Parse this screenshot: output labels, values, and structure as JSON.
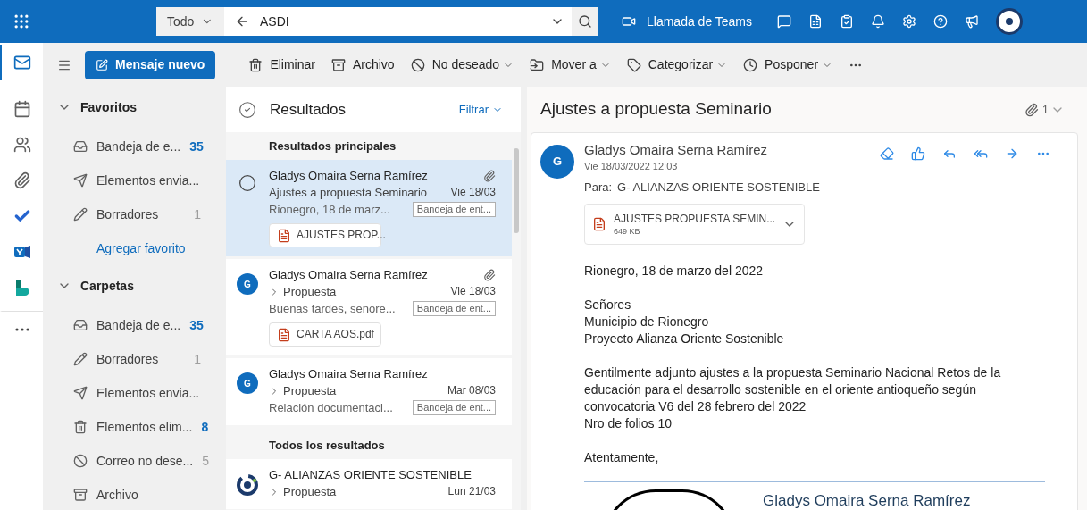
{
  "top_bar": {
    "search": {
      "scope": "Todo",
      "value": "ASDI"
    },
    "teams_call": "Llamada de Teams"
  },
  "app_rail": [
    {
      "kind": "mail",
      "selected": true
    },
    {
      "kind": "calendar",
      "selected": false
    },
    {
      "kind": "people",
      "selected": false
    },
    {
      "kind": "files",
      "selected": false
    },
    {
      "kind": "todo",
      "selected": false
    },
    {
      "kind": "yammer",
      "selected": false
    },
    {
      "kind": "bookings",
      "selected": false
    },
    {
      "kind": "more",
      "selected": false
    }
  ],
  "toolbar": {
    "new_message": "Mensaje nuevo",
    "actions": [
      {
        "kind": "delete",
        "label": "Eliminar",
        "dropdown": false
      },
      {
        "kind": "archive",
        "label": "Archivo",
        "dropdown": false
      },
      {
        "kind": "junk",
        "label": "No deseado",
        "dropdown": true
      },
      {
        "kind": "move",
        "label": "Mover a",
        "dropdown": true
      },
      {
        "kind": "categorize",
        "label": "Categorizar",
        "dropdown": true
      },
      {
        "kind": "snooze",
        "label": "Posponer",
        "dropdown": true
      }
    ]
  },
  "folders": {
    "sections": [
      {
        "title": "Favoritos",
        "expanded": true,
        "add_link": "Agregar favorito",
        "items": [
          {
            "kind": "inbox",
            "label": "Bandeja de e...",
            "count": "35",
            "unread": true
          },
          {
            "kind": "sent",
            "label": "Elementos envia..."
          },
          {
            "kind": "drafts",
            "label": "Borradores",
            "count": "1",
            "unread": false
          }
        ]
      },
      {
        "title": "Carpetas",
        "expanded": true,
        "items": [
          {
            "kind": "inbox",
            "label": "Bandeja de e...",
            "count": "35",
            "unread": true
          },
          {
            "kind": "drafts",
            "label": "Borradores",
            "count": "1",
            "unread": false
          },
          {
            "kind": "sent",
            "label": "Elementos envia..."
          },
          {
            "kind": "deleted",
            "label": "Elementos elim...",
            "count": "8",
            "unread": true
          },
          {
            "kind": "junk",
            "label": "Correo no dese...",
            "count": "5",
            "unread": false
          },
          {
            "kind": "archive",
            "label": "Archivo"
          }
        ]
      }
    ]
  },
  "message_list": {
    "title": "Resultados",
    "filter": "Filtrar",
    "groups": [
      {
        "title": "Resultados principales",
        "messages": [
          {
            "selected": true,
            "sender": "Gladys Omaira Serna Ramírez",
            "subject": "Ajustes a propuesta Seminario",
            "threaded": false,
            "date": "Vie 18/03",
            "preview": "Rionegro, 18 de marz...",
            "folder": "Bandeja de ent...",
            "has_attachment": true,
            "attachment": "AJUSTES PROP..."
          },
          {
            "selected": false,
            "avatar": {
              "kind": "initial",
              "initial": "G"
            },
            "sender": "Gladys Omaira Serna Ramírez",
            "subject": "Propuesta",
            "threaded": true,
            "date": "Vie 18/03",
            "preview": "Buenas tardes, señore...",
            "folder": "Bandeja de ent...",
            "has_attachment": true,
            "attachment": "CARTA AOS.pdf"
          },
          {
            "selected": false,
            "avatar": {
              "kind": "initial",
              "initial": "G"
            },
            "sender": "Gladys Omaira Serna Ramírez",
            "subject": "Propuesta",
            "threaded": true,
            "date": "Mar 08/03",
            "preview": "Relación documentaci...",
            "folder": "Bandeja de ent...",
            "has_attachment": false
          }
        ]
      },
      {
        "title": "Todos los resultados",
        "messages": [
          {
            "selected": false,
            "avatar": {
              "kind": "logo"
            },
            "sender": "G- ALIANZAS ORIENTE SOSTENIBLE",
            "subject": "Propuesta",
            "threaded": true,
            "date": "Lun 21/03",
            "has_attachment": false
          }
        ]
      }
    ]
  },
  "reading_pane": {
    "subject": "Ajustes a propuesta Seminario",
    "attachment_count": "1",
    "message": {
      "initial": "G",
      "sender": "Gladys Omaira Serna Ramírez",
      "date": "Vie 18/03/2022 12:03",
      "to_label": "Para:",
      "to": "G- ALIANZAS ORIENTE SOSTENIBLE",
      "attachment": {
        "name": "AJUSTES PROPUESTA SEMIN...",
        "size": "649 KB"
      },
      "body": [
        [
          "Rionegro, 18 de marzo del 2022"
        ],
        [
          "Señores",
          "Municipio de Rionegro",
          "Proyecto Alianza Oriente Sostenible"
        ],
        [
          "Gentilmente adjunto ajustes a la propuesta Seminario Nacional Retos de la educación para el desarrollo sostenible en el oriente antioqueño según convocatoria V6 del 28 febrero del 2022",
          "Nro de folios 10"
        ],
        [
          "Atentamente,"
        ]
      ],
      "signature": {
        "name": "Gladys Omaira Serna Ramírez"
      }
    }
  }
}
